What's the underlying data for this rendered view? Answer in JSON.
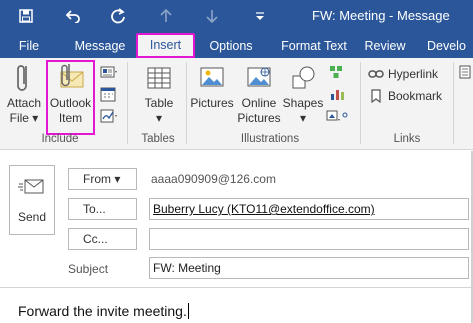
{
  "titlebar": {
    "title": "FW: Meeting  -  Message"
  },
  "tabs": [
    {
      "label": "File"
    },
    {
      "label": "Message"
    },
    {
      "label": "Insert"
    },
    {
      "label": "Options"
    },
    {
      "label": "Format Text"
    },
    {
      "label": "Review"
    },
    {
      "label": "Develo"
    }
  ],
  "ribbon": {
    "include": {
      "label": "Include",
      "attach_line1": "Attach",
      "attach_line2": "File ▾",
      "outlook_line1": "Outlook",
      "outlook_line2": "Item"
    },
    "tables": {
      "label": "Tables",
      "table_line1": "Table",
      "table_line2": "▾"
    },
    "illustrations": {
      "label": "Illustrations",
      "pictures": "Pictures",
      "online_line1": "Online",
      "online_line2": "Pictures",
      "shapes_line1": "Shapes",
      "shapes_line2": "▾"
    },
    "links": {
      "label": "Links",
      "hyperlink": "Hyperlink",
      "bookmark": "Bookmark"
    }
  },
  "compose": {
    "send_label": "Send",
    "from_button": "From ▾",
    "from_address": "aaaa090909@126.com",
    "to_button": "To...",
    "to_value": "Buberry Lucy (KTO11@extendoffice.com)",
    "cc_button": "Cc...",
    "cc_value": "",
    "subject_label": "Subject",
    "subject_value": "FW: Meeting",
    "body": "Forward the invite meeting."
  },
  "colors": {
    "accent": "#2b579a",
    "highlight": "#e316d3"
  }
}
